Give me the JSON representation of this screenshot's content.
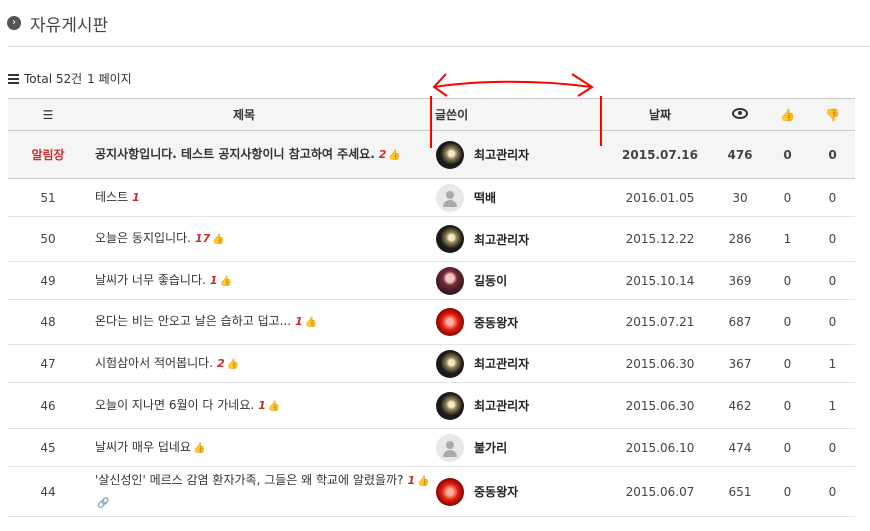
{
  "board": {
    "title": "자유게시판",
    "title_icon": "chevron-right-circle-icon"
  },
  "summary": {
    "icon": "list-icon",
    "total": "Total 52건",
    "pages": "1 페이지"
  },
  "columns": {
    "num_icon": "numbered-list-icon",
    "title": "제목",
    "writer": "글쓴이",
    "date": "날짜",
    "views_icon": "eye-icon",
    "likes_icon": "thumbs-up-icon",
    "dislikes_icon": "thumbs-down-icon"
  },
  "rows": [
    {
      "num": "알림장",
      "notice": true,
      "title": "공지사항입니다. 테스트 공지사항이니 참고하여 주세요.",
      "comments": "2",
      "thumb": true,
      "link": false,
      "writer": "최고관리자",
      "avatar": "dark-avatar",
      "date": "2015.07.16",
      "views": "476",
      "likes": "0",
      "dislikes": "0"
    },
    {
      "num": "51",
      "notice": false,
      "title": "테스트",
      "comments": "1",
      "thumb": false,
      "link": false,
      "writer": "떡배",
      "avatar": "default-avatar",
      "date": "2016.01.05",
      "views": "30",
      "likes": "0",
      "dislikes": "0"
    },
    {
      "num": "50",
      "notice": false,
      "title": "오늘은 동지입니다.",
      "comments": "17",
      "thumb": true,
      "link": false,
      "writer": "최고관리자",
      "avatar": "dark-avatar",
      "date": "2015.12.22",
      "views": "286",
      "likes": "1",
      "dislikes": "0"
    },
    {
      "num": "49",
      "notice": false,
      "title": "날씨가 너무 좋습니다.",
      "comments": "1",
      "thumb": true,
      "link": false,
      "writer": "길동이",
      "avatar": "girl-avatar",
      "date": "2015.10.14",
      "views": "369",
      "likes": "0",
      "dislikes": "0"
    },
    {
      "num": "48",
      "notice": false,
      "title": "온다는 비는 안오고 날은 습하고 덥고...",
      "comments": "1",
      "thumb": true,
      "link": false,
      "writer": "중동왕자",
      "avatar": "red-avatar",
      "date": "2015.07.21",
      "views": "687",
      "likes": "0",
      "dislikes": "0"
    },
    {
      "num": "47",
      "notice": false,
      "title": "시험삼아서 적어봅니다.",
      "comments": "2",
      "thumb": true,
      "link": false,
      "writer": "최고관리자",
      "avatar": "dark-avatar",
      "date": "2015.06.30",
      "views": "367",
      "likes": "0",
      "dislikes": "1"
    },
    {
      "num": "46",
      "notice": false,
      "title": "오늘이 지나면 6월이 다 가네요.",
      "comments": "1",
      "thumb": true,
      "link": false,
      "writer": "최고관리자",
      "avatar": "dark-avatar",
      "date": "2015.06.30",
      "views": "462",
      "likes": "0",
      "dislikes": "1"
    },
    {
      "num": "45",
      "notice": false,
      "title": "날씨가 매우 덥네요",
      "comments": "",
      "thumb": true,
      "link": false,
      "writer": "불가리",
      "avatar": "default-avatar",
      "date": "2015.06.10",
      "views": "474",
      "likes": "0",
      "dislikes": "0"
    },
    {
      "num": "44",
      "notice": false,
      "title": "'살신성인' 메르스 감염 환자가족, 그들은 왜 학교에 알렸을까?",
      "comments": "1",
      "thumb": true,
      "link": true,
      "writer": "중동왕자",
      "avatar": "red-avatar",
      "date": "2015.06.07",
      "views": "651",
      "likes": "0",
      "dislikes": "0"
    }
  ],
  "annotation": {
    "color": "#ff0000",
    "shape": "double-headed-arrow-and-vertical-lines"
  }
}
